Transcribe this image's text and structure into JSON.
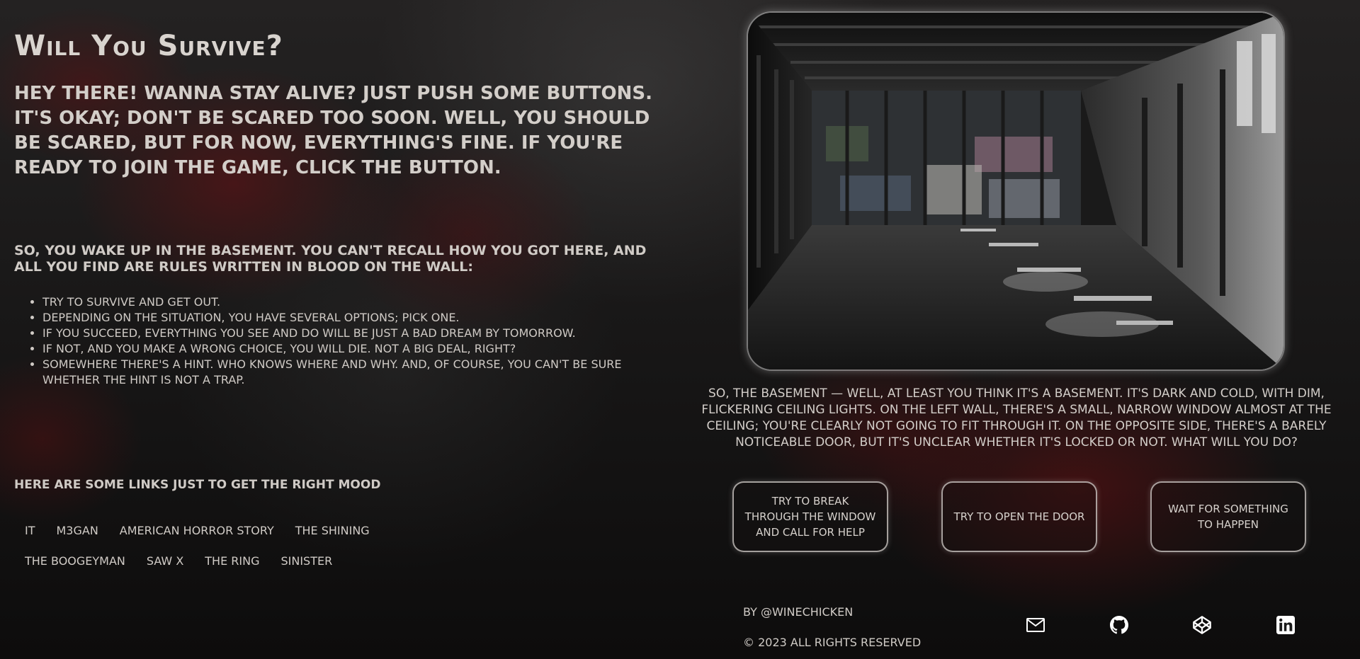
{
  "colors": {
    "text": "#d6d1cc",
    "blood_red": "#7a0f12",
    "background": "#171616",
    "frame_border": "#c8c8c8"
  },
  "header": {
    "title": "Will You Survive?"
  },
  "intro": {
    "text": "Hey there! Wanna stay alive? Just push some buttons. It's okay; don't be scared too soon. Well, you should be scared, but for now, everything's fine. If you're ready to join the game, click the button."
  },
  "story": {
    "wake_text": "So, you wake up in the basement. You can't recall how you got here, and all you find are rules written in blood on the wall:",
    "rules": [
      "Try to survive and get out.",
      "Depending on the situation, you have several options; pick one.",
      "If you succeed, everything you see and do will be just a bad dream by tomorrow.",
      "If not, and you make a wrong choice, you will die. Not a big deal, right?",
      "Somewhere there's a hint. Who knows where and why. And, of course, you can't be sure whether the hint is not a trap."
    ]
  },
  "links": {
    "heading": "Here are some links just to get the right mood",
    "row1": [
      "It",
      "M3GAN",
      "American Horror Story",
      "The Shining"
    ],
    "row2": [
      "The Boogeyman",
      "Saw X",
      "The Ring",
      "Sinister"
    ]
  },
  "scene": {
    "image_icon": "abandoned-basement-image",
    "description": "So, the basement — well, at least you think it's a basement. It's dark and cold, with dim, flickering ceiling lights. On the left wall, there's a small, narrow window almost at the ceiling; you're clearly not going to fit through it. On the opposite side, there's a barely noticeable door, but it's unclear whether it's locked or not. What will you do?",
    "choices": [
      "Try to break through the window and call for help",
      "Try to open the door",
      "Wait for something to happen"
    ]
  },
  "footer": {
    "credit": "by @winechicken",
    "copyright": "© 2023 All rights reserved",
    "social_icons": [
      "mail-icon",
      "github-icon",
      "codepen-icon",
      "linkedin-icon"
    ]
  }
}
